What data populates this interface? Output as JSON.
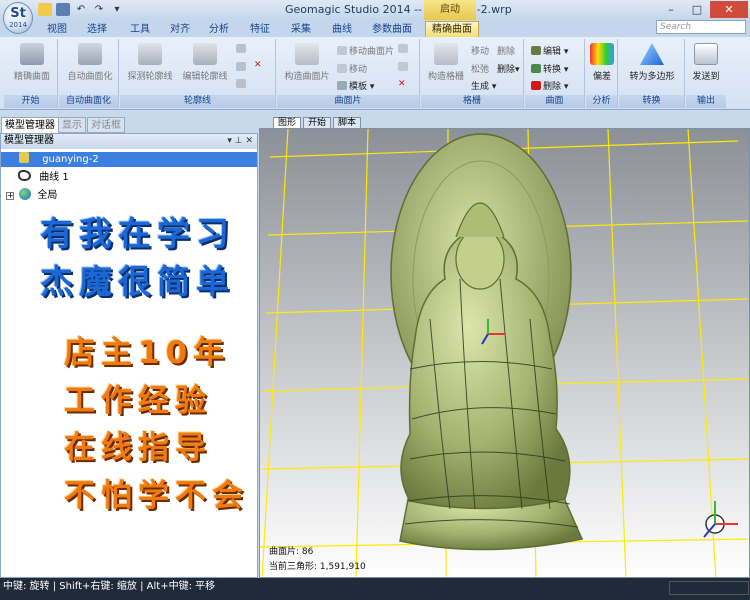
{
  "window": {
    "title": "Geomagic Studio 2014 -- guanying-2.wrp",
    "context_tab_title": "启动",
    "logo": {
      "text": "St",
      "version": "2014"
    }
  },
  "ribbon": {
    "tabs": [
      "视图",
      "选择",
      "工具",
      "对齐",
      "分析",
      "特征",
      "采集",
      "曲线",
      "参数曲面",
      "精确曲面"
    ],
    "active_tab": "精确曲面",
    "search_placeholder": "Search",
    "groups": {
      "start": {
        "label": "开始",
        "button": "精确曲面"
      },
      "autosurface": {
        "label": "自动曲面化",
        "button": "自动曲面化"
      },
      "contour": {
        "label": "轮廓线",
        "detect": "探测轮廓线",
        "edit": "编辑轮廓线"
      },
      "patch": {
        "label": "曲面片",
        "construct": "构造曲面片",
        "move": "移动曲面片",
        "shift": "移动",
        "template": "模板"
      },
      "grid": {
        "label": "格栅",
        "construct": "构造格栅",
        "move": "移动",
        "delete": "删除",
        "relax": "松弛",
        "generate": "生成"
      },
      "surface": {
        "label": "曲面",
        "edit": "编辑",
        "convert": "转换",
        "delete": "删除"
      },
      "analysis": {
        "label": "分析",
        "deviation": "偏差"
      },
      "convert": {
        "label": "转换",
        "to_polygon": "转为多边形"
      },
      "output": {
        "label": "输出",
        "send_to": "发送到"
      }
    }
  },
  "panel": {
    "tabs": [
      "模型管理器",
      "显示",
      "对话框"
    ],
    "header": "模型管理器",
    "header_buttons": "▾ ⊥ ✕",
    "tree": [
      {
        "label": "guanying-2",
        "selected": true
      },
      {
        "label": "曲线 1"
      },
      {
        "label": "全局"
      }
    ]
  },
  "promo": {
    "blue": [
      "有我在学习",
      "杰魔很简单"
    ],
    "orange": [
      "店主10年",
      "工作经验",
      "在线指导",
      "不怕学不会"
    ]
  },
  "viewport": {
    "tabs": [
      "图形",
      "开始",
      "脚本"
    ],
    "patch_count_label": "曲面片: 86",
    "triangle_count_label": "当前三角形: 1,591,910"
  },
  "status": {
    "text": "中键: 旋转 | Shift+右键: 缩放 | Alt+中键: 平移"
  },
  "colors": {
    "ribbon_bg": "#dbe6f4",
    "selection": "#3d7fe0",
    "model_green": "#a7b776",
    "grid_yellow": "#ffea00",
    "promo_blue": "#1b67d6",
    "promo_orange": "#f07a10"
  }
}
